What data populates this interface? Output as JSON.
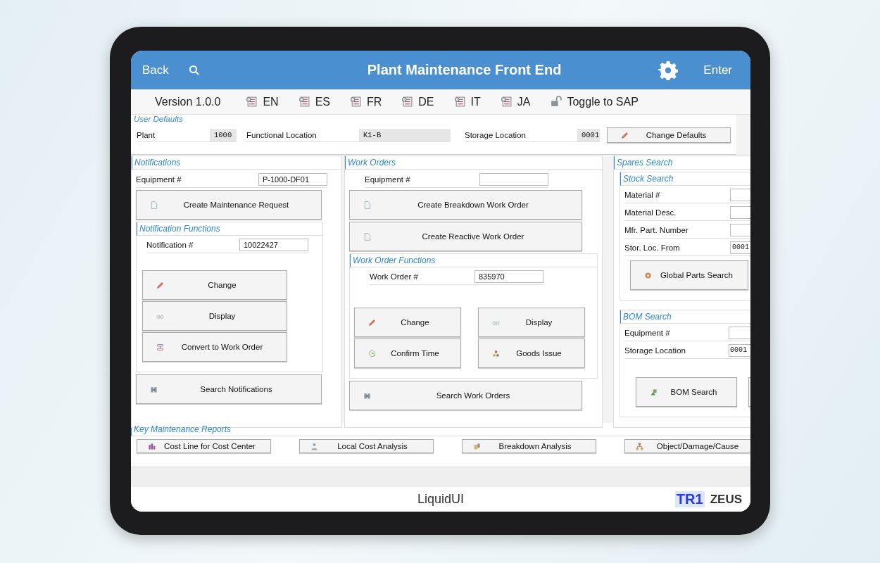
{
  "header": {
    "back": "Back",
    "title": "Plant Maintenance Front End",
    "enter": "Enter"
  },
  "toolbar": {
    "version": "Version 1.0.0",
    "languages": [
      "EN",
      "ES",
      "FR",
      "DE",
      "IT",
      "JA"
    ],
    "toggle": "Toggle to SAP"
  },
  "user_defaults": {
    "title": "User Defaults",
    "fields": [
      {
        "label": "Plant",
        "value": "1000"
      },
      {
        "label": "Functional Location",
        "value": "K1-B"
      },
      {
        "label": "Storage Location",
        "value": "0001"
      }
    ],
    "button": {
      "label": "Change Defaults",
      "kind": "pencil"
    }
  },
  "notifications": {
    "title": "Notifications",
    "equipment": {
      "label": "Equipment #",
      "value": "P-1000-DF01"
    },
    "create": {
      "label": "Create Maintenance Request",
      "kind": "document"
    },
    "functions": {
      "title": "Notification Functions",
      "field": {
        "label": "Notification #",
        "value": "10022427"
      },
      "buttons": [
        {
          "label": "Change",
          "kind": "pencil"
        },
        {
          "label": "Display",
          "kind": "glasses"
        },
        {
          "label": "Convert to Work Order",
          "kind": "convert"
        }
      ]
    },
    "search": {
      "label": "Search Notifications",
      "kind": "binoculars"
    }
  },
  "work_orders": {
    "title": "Work Orders",
    "equipment": {
      "label": "Equipment #"
    },
    "create": [
      {
        "label": "Create Breakdown Work Order",
        "kind": "document"
      },
      {
        "label": "Create Reactive Work Order",
        "kind": "document"
      }
    ],
    "functions": {
      "title": "Work Order Functions",
      "field": {
        "label": "Work Order #",
        "value": "835970"
      },
      "buttons": [
        {
          "label": "Change",
          "kind": "pencil"
        },
        {
          "label": "Display",
          "kind": "glasses"
        },
        {
          "label": "Confirm Time",
          "kind": "clock"
        },
        {
          "label": "Goods Issue",
          "kind": "boxes"
        }
      ]
    },
    "search": {
      "label": "Search Work Orders",
      "kind": "binoculars"
    }
  },
  "spares": {
    "title": "Spares Search",
    "stock": {
      "title": "Stock Search",
      "fields": [
        {
          "label": "Material #"
        },
        {
          "label": "Material Desc."
        },
        {
          "label": "Mfr. Part. Number"
        },
        {
          "label": "Stor. Loc. From",
          "value": "0001"
        }
      ],
      "button": {
        "label": "Global Parts Search",
        "kind": "disc"
      }
    },
    "bom": {
      "title": "BOM Search",
      "fields": [
        {
          "label": "Equipment #"
        },
        {
          "label": "Storage Location",
          "value": "0001"
        }
      ],
      "button": {
        "label": "BOM Search",
        "kind": "bom"
      }
    }
  },
  "reports": {
    "title": "Key Maintenance Reports",
    "buttons": [
      {
        "label": "Cost Line for Cost Center",
        "kind": "chart"
      },
      {
        "label": "Local Cost Analysis",
        "kind": "person"
      },
      {
        "label": "Breakdown Analysis",
        "kind": "tools"
      },
      {
        "label": "Object/Damage/Cause",
        "kind": "hierarchy"
      }
    ]
  },
  "footer": {
    "brand": "LiquidUI",
    "systems": [
      "TR1",
      "ZEUS"
    ]
  }
}
